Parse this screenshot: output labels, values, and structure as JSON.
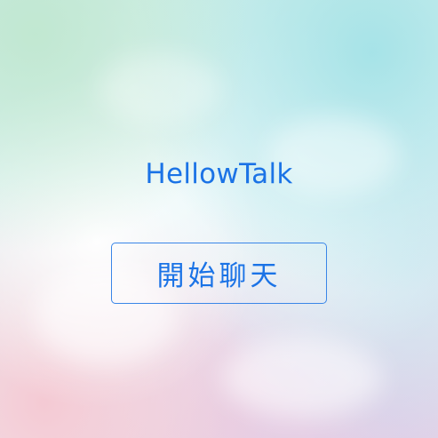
{
  "app": {
    "title": "HellowTalk"
  },
  "start_button": {
    "label": "開始聊天"
  },
  "colors": {
    "accent": "#1b73e6",
    "button_border": "#3a86e8"
  }
}
